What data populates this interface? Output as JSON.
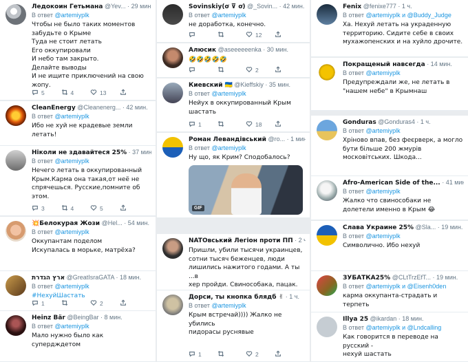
{
  "reply_prefix": "В ответ",
  "tweets": [
    {
      "name": "Ледокоин Гетьмана",
      "meta": "@Yev... · 29 мин.",
      "reply_to": "@artemiyplk",
      "text": "Чтобы не было таких моментов\nзабудьте о Крыме\nТуда не стоит летать\nЕго оккупировали\nИ небо там закрыто.\nДелайте выводы\nИ не ищите приключений на свою\nжопу.",
      "replies": "5",
      "retweets": "4",
      "likes": "13"
    },
    {
      "name": "CleanEnergy",
      "meta": "@Cleanenerg... · 42 мин.",
      "reply_to": "@artemiyplk",
      "text": "Ибо не хуй не крадевые земли летать!",
      "replies": "",
      "retweets": "",
      "likes": ""
    },
    {
      "name": "Ніколи не здавайтеся 25%",
      "meta": "· 37 мин.",
      "reply_to": "@artemiyplk",
      "text": "Нечего летать в оккупированный\nКрым.Карма она такая,от неё не\nспрячешься. Русские,помните об\nэтом.",
      "replies": "3",
      "retweets": "4",
      "likes": "5"
    },
    {
      "name": "💥Белокурая Жози",
      "meta": "@Hel... · 54 мин.",
      "reply_to": "@artemiyplk",
      "text": "Оккупантам поделом\n Искупалась в морьке, матрёха?",
      "replies": "",
      "retweets": "",
      "likes": ""
    },
    {
      "name": "ארץ הגדרת",
      "meta": "@GreatIsraGATA · 18 мин.",
      "reply_to": "@artemiyplk",
      "text": "#НехуйШастать",
      "replies": "1",
      "retweets": "",
      "likes": "2"
    },
    {
      "name": "Heinz Bär",
      "meta": "@BeingBar · 8 мин.",
      "reply_to": "@artemiyplk",
      "text": "Мало нужно было как супердждетом",
      "replies": "",
      "retweets": "",
      "likes": ""
    },
    {
      "name": "Sovinskiy(ơ ⊽ ơ)",
      "meta": "@_Sovin... · 42 мин.",
      "reply_to": "@artemiyplk",
      "text": "не доработка, конечно.",
      "replies": "",
      "retweets": "",
      "likes": "12"
    },
    {
      "name": "Алюсик",
      "meta": "@aseeeeeenka · 30 мин.",
      "reply_to": "",
      "text": "🤣🤣🤣🤣🤣",
      "replies": "",
      "retweets": "",
      "likes": "2"
    },
    {
      "name": "Киевский 🇺🇦",
      "meta": "@Kieffskiy · 35 мин.",
      "reply_to": "@artemiyplk",
      "text": "Нейух в оккупированный Крым\nшастать",
      "replies": "1",
      "retweets": "",
      "likes": "18"
    },
    {
      "name": "Роман Левандівський",
      "meta": "@ro... · 1 мин.",
      "reply_to": "@artemiyplk",
      "text": "Ну що, як Крим? Сподобалось?",
      "replies": "",
      "retweets": "",
      "likes": "",
      "gif": "GIF"
    },
    {
      "name": "NATOвський Легіон проти ПП",
      "meta": "· 2 ч.",
      "reply_to": "",
      "text": "Пришли, убили тысячи украинцев,\nсотни тысяч беженцев, люди\nлишились нажитого годами. А ты ...в\nхер пройди. Свинособака, пацак.",
      "replies": "",
      "retweets": "",
      "likes": ""
    },
    {
      "name": "Дорси, ты кнопка блядб ✌",
      "meta": "· 1 ч.",
      "reply_to": "@artemiyplk",
      "text": "Крым встречай)))) Жалко не убились\nпидорасы руснявые",
      "replies": "1",
      "retweets": "",
      "likes": "2"
    },
    {
      "name": "Fenix",
      "meta": "@fenixe777 · 1 ч.",
      "reply_to": "@artemiyplk и @Buddy_Judge",
      "text": "Ха. Нехуй летать на украденную\nтерриторию. Сидите себе в своих\nмухажопенских и на хуйло дрочите.",
      "replies": "",
      "retweets": "",
      "likes": ""
    },
    {
      "name": "Покращеный навсегда",
      "meta": "· 14 мин.",
      "reply_to": "@artemiyplk",
      "text": "Предупреждали же, не летать в\n\"нашем небе\" в Крымнаш",
      "replies": "",
      "retweets": "",
      "likes": ""
    },
    {
      "name": "Gonduras",
      "meta": "@Gonduras4 · 1 ч.",
      "reply_to": "@artemiyplk",
      "text": "Хріново впав, без феєрверк, а могло\nбути більше 200 жмурів\nмосковітських. Шкода...",
      "replies": "",
      "retweets": "",
      "likes": ""
    },
    {
      "name": "Afro-American Side of the...",
      "meta": "· 41 мин.",
      "reply_to": "@artemiyplk",
      "text": "Жалко что свинособаки не\nдолетели именно в Крым 😂",
      "replies": "",
      "retweets": "",
      "likes": ""
    },
    {
      "name": "Слава Украине 25%",
      "meta": "@Sla... · 19 мин.",
      "reply_to": "@artemiyplk",
      "text": "Символично. Ибо нехуй",
      "replies": "",
      "retweets": "",
      "likes": ""
    },
    {
      "name": "ЗУБАТКА25%",
      "meta": "@CLtTrzEfT... · 19 мин.",
      "reply_to": "@artemiyplk и @Eisenh0den",
      "text": "карма оккупанта-страдать и терпеть",
      "replies": "",
      "retweets": "",
      "likes": ""
    },
    {
      "name": "Illya 25",
      "meta": "@ikardan · 18 мин.",
      "reply_to": "@artemiyplk и @Lndcalling",
      "text": "Как говорится в переводе на русский -\nнехуй шастать",
      "replies": "",
      "retweets": "",
      "likes": ""
    }
  ]
}
